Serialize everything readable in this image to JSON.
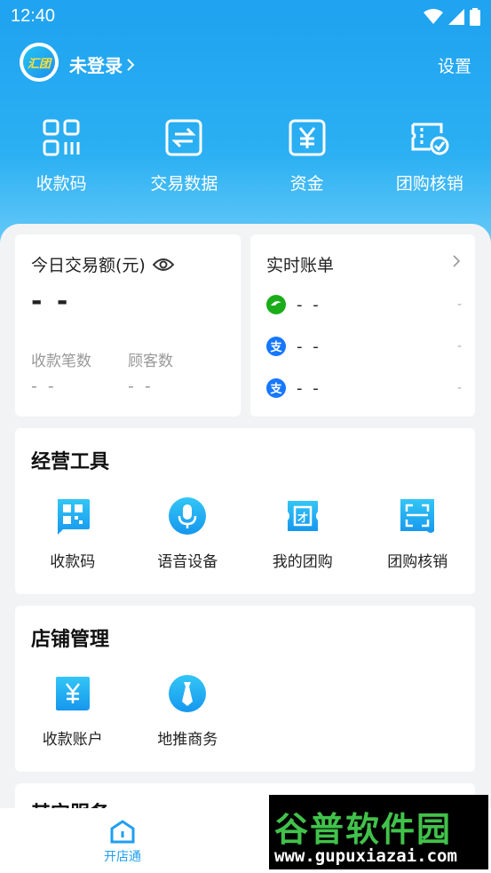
{
  "status_bar": {
    "time": "12:40"
  },
  "header": {
    "avatar_text": "汇团",
    "login_label": "未登录",
    "settings_label": "设置"
  },
  "quick_actions": [
    {
      "label": "收款码",
      "icon": "qr-grid-icon"
    },
    {
      "label": "交易数据",
      "icon": "exchange-icon"
    },
    {
      "label": "资金",
      "icon": "yuan-icon"
    },
    {
      "label": "团购核销",
      "icon": "ticket-check-icon"
    }
  ],
  "today_card": {
    "title": "今日交易额(元)",
    "value": "- -",
    "stats": [
      {
        "label": "收款笔数",
        "value": "- -"
      },
      {
        "label": "顾客数",
        "value": "- -"
      }
    ]
  },
  "bill_card": {
    "title": "实时账单",
    "rows": [
      {
        "amount": "- -",
        "trail": "-",
        "icon": "wechat-icon",
        "color": "#1aad19"
      },
      {
        "amount": "- -",
        "trail": "-",
        "icon": "alipay-icon",
        "color": "#1677ff"
      },
      {
        "amount": "- -",
        "trail": "-",
        "icon": "alipay-icon",
        "color": "#1677ff"
      }
    ]
  },
  "tools": {
    "title": "经营工具",
    "items": [
      {
        "label": "收款码"
      },
      {
        "label": "语音设备"
      },
      {
        "label": "我的团购"
      },
      {
        "label": "团购核销"
      }
    ]
  },
  "store": {
    "title": "店铺管理",
    "items": [
      {
        "label": "收款账户"
      },
      {
        "label": "地推商务"
      }
    ]
  },
  "other": {
    "title": "其它服务"
  },
  "tabbar": {
    "tab_label": "开店通"
  },
  "watermark": {
    "top": "谷普软件园",
    "bottom": "www.gupuxiazai.com"
  },
  "colors": {
    "accent": "#1e9ff2",
    "icon_gradient_start": "#33c6f6",
    "icon_gradient_end": "#1697ee"
  }
}
